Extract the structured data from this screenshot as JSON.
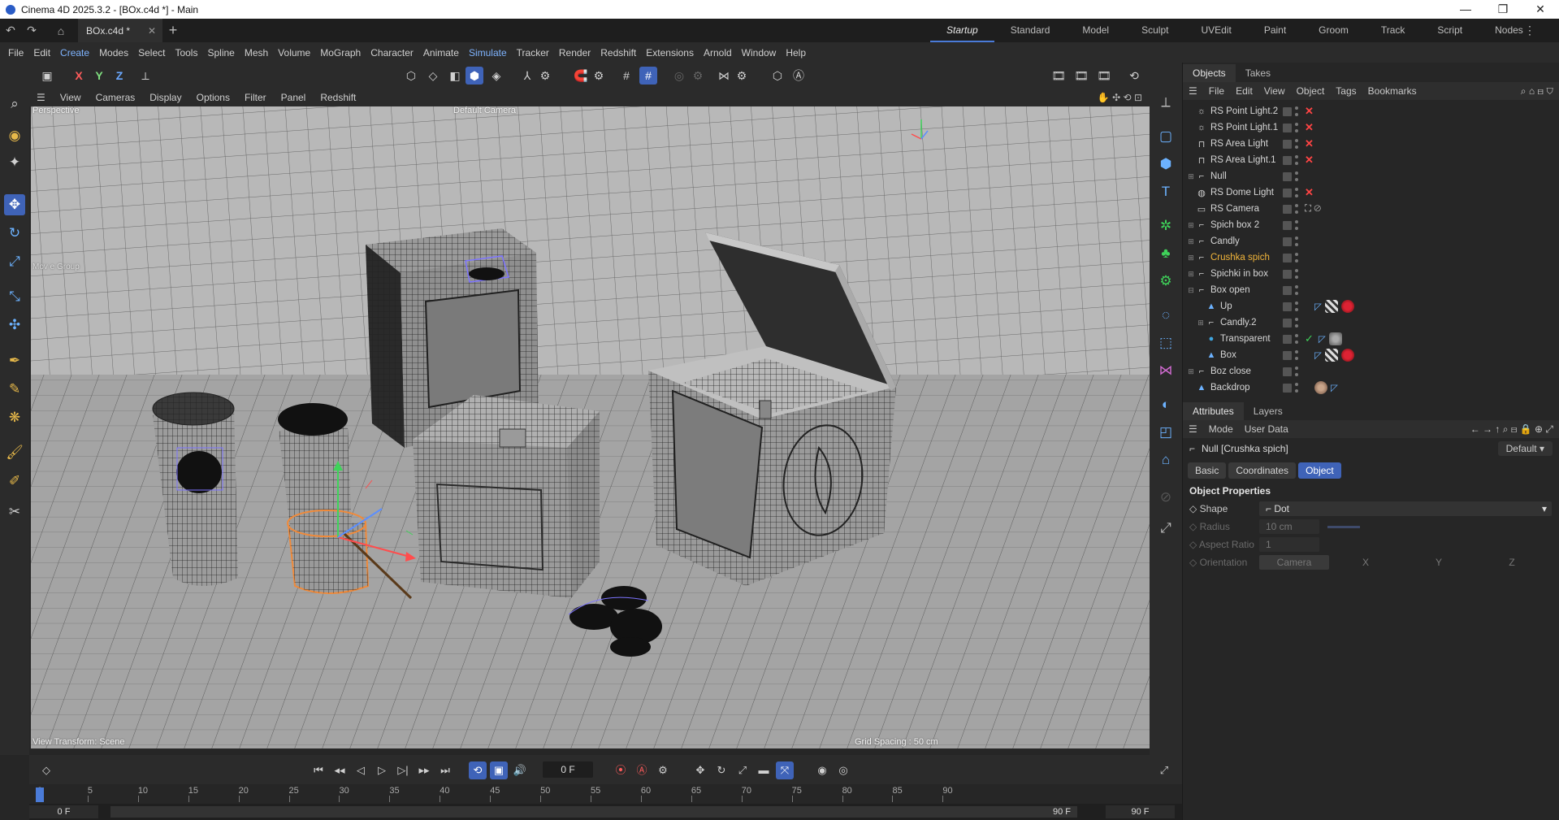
{
  "titlebar": {
    "title": "Cinema 4D 2025.3.2 - [BOx.c4d *] - Main",
    "minimize": "—",
    "maximize": "❐",
    "close": "✕"
  },
  "tabbar": {
    "document_tab": "BOx.c4d *",
    "add_tab": "+",
    "layouts": [
      "Startup",
      "Standard",
      "Model",
      "Sculpt",
      "UVEdit",
      "Paint",
      "Groom",
      "Track",
      "Script",
      "Nodes"
    ],
    "active_layout": "Startup"
  },
  "menu": [
    "File",
    "Edit",
    "Create",
    "Modes",
    "Select",
    "Tools",
    "Spline",
    "Mesh",
    "Volume",
    "MoGraph",
    "Character",
    "Animate",
    "Simulate",
    "Tracker",
    "Render",
    "Redshift",
    "Extensions",
    "Arnold",
    "Window",
    "Help"
  ],
  "toolbar": {
    "axis_x": "X",
    "axis_y": "Y",
    "axis_z": "Z"
  },
  "viewport": {
    "menu": [
      "View",
      "Cameras",
      "Display",
      "Options",
      "Filter",
      "Panel",
      "Redshift"
    ],
    "projection": "Perspective",
    "camera": "Default Camera",
    "camera_suffix": "·:",
    "bottom_left": "View Transform: Scene",
    "bottom_right": "Grid Spacing : 50 cm",
    "overlay_small": "Mov e Group"
  },
  "objects_panel": {
    "tabs": [
      "Objects",
      "Takes"
    ],
    "menu": [
      "File",
      "Edit",
      "View",
      "Object",
      "Tags",
      "Bookmarks"
    ],
    "items": [
      {
        "name": "RS Point Light.2",
        "icon": "point-light-icon",
        "status": "x"
      },
      {
        "name": "RS Point Light.1",
        "icon": "point-light-icon",
        "status": "x"
      },
      {
        "name": "RS Area Light",
        "icon": "area-light-icon",
        "status": "x"
      },
      {
        "name": "RS Area Light.1",
        "icon": "area-light-icon",
        "status": "x"
      },
      {
        "name": "Null",
        "icon": "null-icon",
        "status": ""
      },
      {
        "name": "RS Dome Light",
        "icon": "dome-light-icon",
        "status": "x"
      },
      {
        "name": "RS Camera",
        "icon": "camera-icon",
        "status": "cam"
      },
      {
        "name": "Spich box 2",
        "icon": "null-icon",
        "status": ""
      },
      {
        "name": "Candly",
        "icon": "null-icon",
        "status": ""
      },
      {
        "name": "Crushka spich",
        "icon": "null-icon",
        "status": "",
        "selected": true
      },
      {
        "name": "Spichki in box",
        "icon": "null-icon",
        "status": ""
      },
      {
        "name": "Box open",
        "icon": "null-icon",
        "status": ""
      },
      {
        "name": "Up",
        "icon": "poly-icon",
        "status": "tags-red"
      },
      {
        "name": "Candly.2",
        "icon": "null-icon",
        "status": ""
      },
      {
        "name": "Transparent",
        "icon": "sphere-icon",
        "status": "tags-grey"
      },
      {
        "name": "Box",
        "icon": "poly-icon",
        "status": "tags-red"
      },
      {
        "name": "Boz close",
        "icon": "null-icon",
        "status": ""
      },
      {
        "name": "Backdrop",
        "icon": "poly-icon",
        "status": "tags-backdrop"
      }
    ]
  },
  "attributes": {
    "tabs": [
      "Attributes",
      "Layers"
    ],
    "menu": [
      "Mode",
      "User Data"
    ],
    "object_title": "Null [Crushka spich]",
    "preset": "Default",
    "buttons": [
      "Basic",
      "Coordinates",
      "Object"
    ],
    "active_button": "Object",
    "section": "Object Properties",
    "props": {
      "shape_label": "Shape",
      "shape_value": "Dot",
      "radius_label": "Radius",
      "radius_value": "10 cm",
      "aspect_label": "Aspect Ratio",
      "aspect_value": "1",
      "orientation_label": "Orientation",
      "orientation_value": "Camera",
      "orient_x": "X",
      "orient_y": "Y",
      "orient_z": "Z"
    }
  },
  "timeline": {
    "current_frame": "0 F",
    "ticks": [
      "0",
      "5",
      "10",
      "15",
      "20",
      "25",
      "30",
      "35",
      "40",
      "45",
      "50",
      "55",
      "60",
      "65",
      "70",
      "75",
      "80",
      "85",
      "90"
    ],
    "start_frame": "0 F",
    "preview_start": "0 F",
    "preview_end": "90 F",
    "end_frame": "90 F"
  }
}
